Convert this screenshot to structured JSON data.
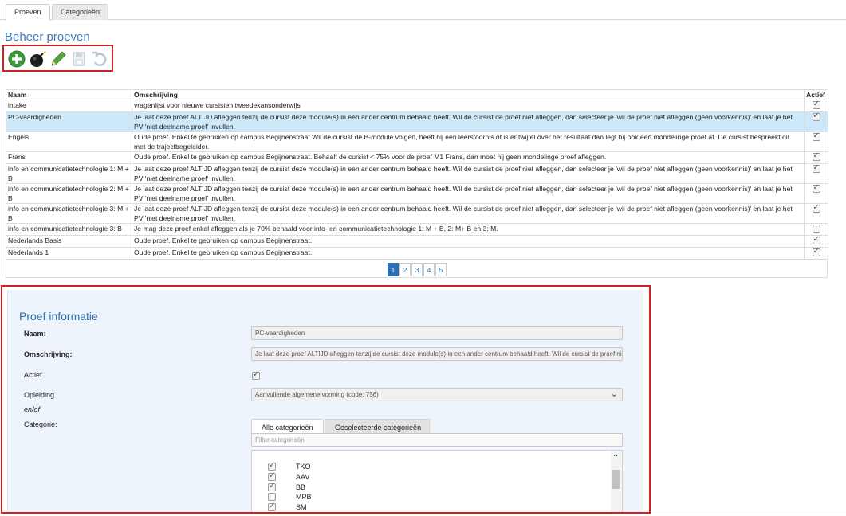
{
  "tabs": [
    {
      "label": "Proeven"
    },
    {
      "label": "Categorieën"
    }
  ],
  "page_title": "Beheer proeven",
  "toolbar": {
    "add_icon": "plus-circle-icon",
    "delete_icon": "bomb-icon",
    "edit_icon": "pencil-icon",
    "save_icon": "floppy-disk-icon",
    "undo_icon": "undo-icon"
  },
  "table": {
    "headers": {
      "name": "Naam",
      "description": "Omschrijving",
      "active": "Actief"
    },
    "rows": [
      {
        "name": "intake",
        "description": "vragenlijst voor nieuwe cursisten tweedekansonderwijs",
        "active": true
      },
      {
        "name": "PC-vaardigheden",
        "description": "Je laat deze proef ALTIJD afleggen tenzij de cursist deze module(s) in een ander centrum behaald heeft. Wil de cursist de proef niet afleggen, dan selecteer je 'wil de proef niet afleggen (geen voorkennis)' en laat je het PV 'niet deelname proef' invullen.",
        "active": true,
        "selected": true
      },
      {
        "name": "Engels",
        "description": "Oude proef. Enkel te gebruiken op campus Begijnenstraat.Wil de cursist de B-module volgen, heeft hij een leerstoornis of is er twijfel over het resultaat dan legt hij ook een mondelinge proef af. De cursist bespreekt dit met de trajectbegeleider.",
        "active": true
      },
      {
        "name": "Frans",
        "description": "Oude proef. Enkel te gebruiken op campus Begijnenstraat. Behaalt de cursist < 75% voor de proef M1 Frans, dan moet hij geen mondelinge proef afleggen.",
        "active": true
      },
      {
        "name": "info en communicatietechnologie 1: M + B",
        "description": "Je laat deze proef ALTIJD afleggen tenzij de cursist deze module(s) in een ander centrum behaald heeft. Wil de cursist de proef niet afleggen, dan selecteer je 'wil de proef niet afleggen (geen voorkennis)' en laat je het PV 'niet deelname proef' invullen.",
        "active": true
      },
      {
        "name": "info en communicatietechnologie 2: M + B",
        "description": "Je laat deze proef ALTIJD afleggen tenzij de cursist deze module(s) in een ander centrum behaald heeft. Wil de cursist de proef niet afleggen, dan selecteer je 'wil de proef niet afleggen (geen voorkennis)' en laat je het PV 'niet deelname proef' invullen.",
        "active": true
      },
      {
        "name": "info en communicatietechnologie 3: M + B",
        "description": "Je laat deze proef ALTIJD afleggen tenzij de cursist deze module(s) in een ander centrum behaald heeft. Wil de cursist de proef niet afleggen, dan selecteer je 'wil de proef niet afleggen (geen voorkennis)' en laat je het PV 'niet deelname proef' invullen.",
        "active": true
      },
      {
        "name": "info en communicatietechnologie 3: B",
        "description": "Je mag deze proef enkel afleggen als je 70% behaald voor info- en communicatietechnologie 1: M + B, 2: M+ B en 3: M.",
        "active": false
      },
      {
        "name": "Nederlands Basis",
        "description": "Oude proef. Enkel te gebruiken op campus Begijnenstraat.",
        "active": true
      },
      {
        "name": "Nederlands 1",
        "description": "Oude proef. Enkel te gebruiken op campus Begijnenstraat.",
        "active": true
      }
    ]
  },
  "pagination": {
    "pages": [
      "1",
      "2",
      "3",
      "4",
      "5"
    ],
    "current": "1"
  },
  "info": {
    "title": "Proef informatie",
    "name_label": "Naam:",
    "name_value": "PC-vaardigheden",
    "description_label": "Omschrijving:",
    "description_value": "Je laat deze proef ALTIJD afleggen tenzij de cursist deze module(s) in een ander centrum behaald heeft. Wil de cursist de proef niet afleggen, dan selecteer je 'wil de proef niet afleggen (geen voorkennis)' en laat je het PV 'niet deelname proef' invullen.",
    "active_label": "Actief",
    "active_value": true,
    "training_label": "Opleiding",
    "training_value": "Aanvullende algemene vorming (code: 756)",
    "andor_label": "en/of",
    "category_label": "Categorie:",
    "category_tabs": [
      "Alle categorieën",
      "Geselecteerde categorieën"
    ],
    "filter_placeholder": "Filter categorieën",
    "categories": [
      {
        "label": "TKO",
        "checked": true
      },
      {
        "label": "AAV",
        "checked": true
      },
      {
        "label": "BB",
        "checked": true
      },
      {
        "label": "MPB",
        "checked": false
      },
      {
        "label": "SM",
        "checked": true
      }
    ]
  },
  "colors": {
    "accent": "#3d7cb8",
    "highlight": "#d11f1f",
    "selected_row": "#cde8f8"
  }
}
